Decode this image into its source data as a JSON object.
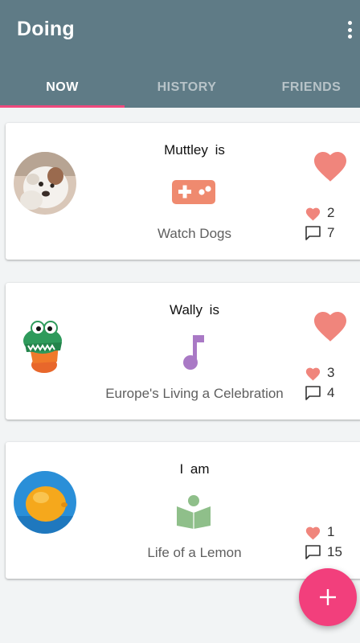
{
  "app": {
    "title": "Doing",
    "colors": {
      "appbar": "#5f7b86",
      "accent": "#f0497e",
      "like": "#f0857c"
    }
  },
  "tabs": [
    {
      "label": "NOW",
      "active": true
    },
    {
      "label": "HISTORY",
      "active": false
    },
    {
      "label": "FRIENDS",
      "active": false
    }
  ],
  "feed": [
    {
      "person": "Muttley  is",
      "avatar": "puppy-avatar",
      "activity_icon": "gamepad-icon",
      "activity_color": "#ef8a6f",
      "activity": "Watch Dogs",
      "likes": "2",
      "comments": "7"
    },
    {
      "person": "Wally  is",
      "avatar": "toy-crocodile-avatar",
      "activity_icon": "music-note-icon",
      "activity_color": "#a979c5",
      "activity": "Europe's Living a Celebration",
      "likes": "3",
      "comments": "4"
    },
    {
      "person": "I  am",
      "avatar": "lemon-avatar",
      "activity_icon": "reading-book-icon",
      "activity_color": "#8fbf8a",
      "activity": "Life of a Lemon",
      "likes": "1",
      "comments": "15"
    }
  ],
  "fab": {
    "icon": "plus-icon"
  }
}
